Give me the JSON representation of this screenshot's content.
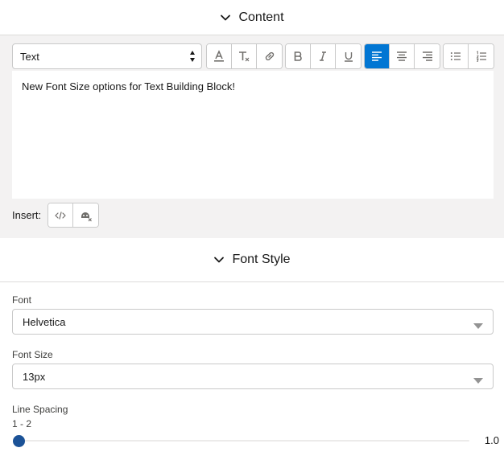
{
  "content_section": {
    "title": "Content"
  },
  "toolbar": {
    "block_format": "Text",
    "buttons": [
      "text-color",
      "remove-format",
      "link",
      "bold",
      "italic",
      "underline",
      "align-left",
      "align-center",
      "align-right",
      "bullet-list",
      "numbered-list"
    ],
    "active": "align-left"
  },
  "editor": {
    "text": "New Font Size options for Text Building Block!"
  },
  "insert": {
    "label": "Insert:"
  },
  "font_style_section": {
    "title": "Font Style"
  },
  "font": {
    "label": "Font",
    "value": "Helvetica"
  },
  "font_size": {
    "label": "Font Size",
    "value": "13px"
  },
  "line_spacing": {
    "label": "Line Spacing",
    "range": "1 - 2",
    "min": 1,
    "max": 2,
    "value": "1.0",
    "fraction": 0
  },
  "colors": {
    "accent": "#0176d3",
    "thumb": "#1b5297",
    "panel_bg": "#f3f2f2",
    "border": "#c9c9c9"
  }
}
